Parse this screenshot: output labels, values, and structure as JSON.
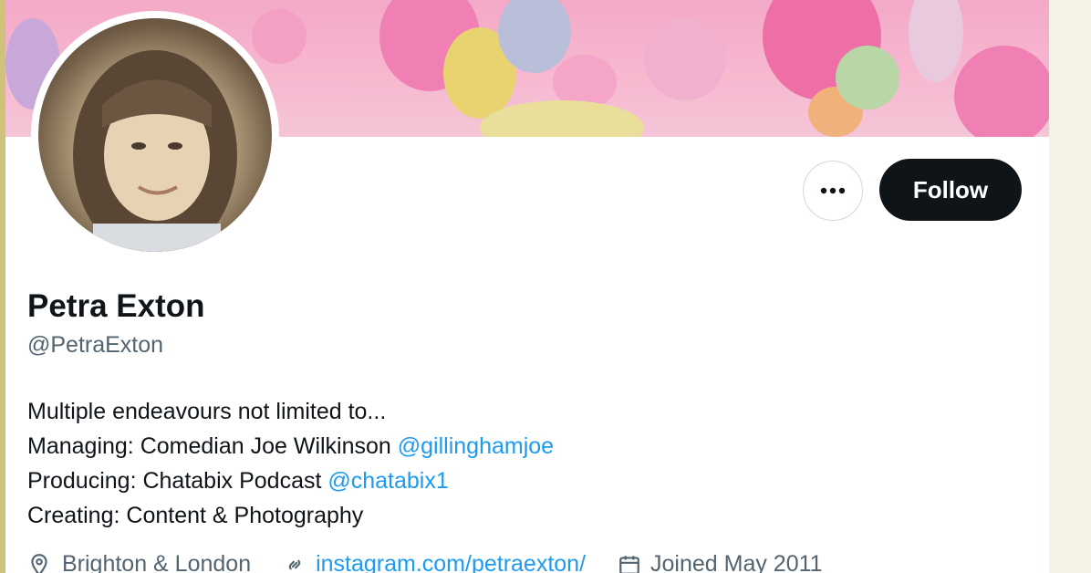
{
  "profile": {
    "display_name": "Petra Exton",
    "handle": "@PetraExton",
    "follow_label": "Follow",
    "more_label": "•••"
  },
  "bio": {
    "line1": "Multiple endeavours not limited to...",
    "line2_text": "Managing: Comedian Joe Wilkinson ",
    "line2_mention": "@gillinghamjoe",
    "line3_text": "Producing: Chatabix Podcast ",
    "line3_mention": "@chatabix1",
    "line4": "Creating: Content & Photography"
  },
  "meta": {
    "location": "Brighton & London",
    "link": "instagram.com/petraexton/",
    "joined": "Joined May 2011"
  },
  "icons": {
    "location": "location-pin-icon",
    "link": "link-icon",
    "calendar": "calendar-icon",
    "more": "more-dots-icon"
  },
  "colors": {
    "follow_bg": "#0f1419",
    "mention": "#1d9bf0",
    "secondary_text": "#536471"
  }
}
